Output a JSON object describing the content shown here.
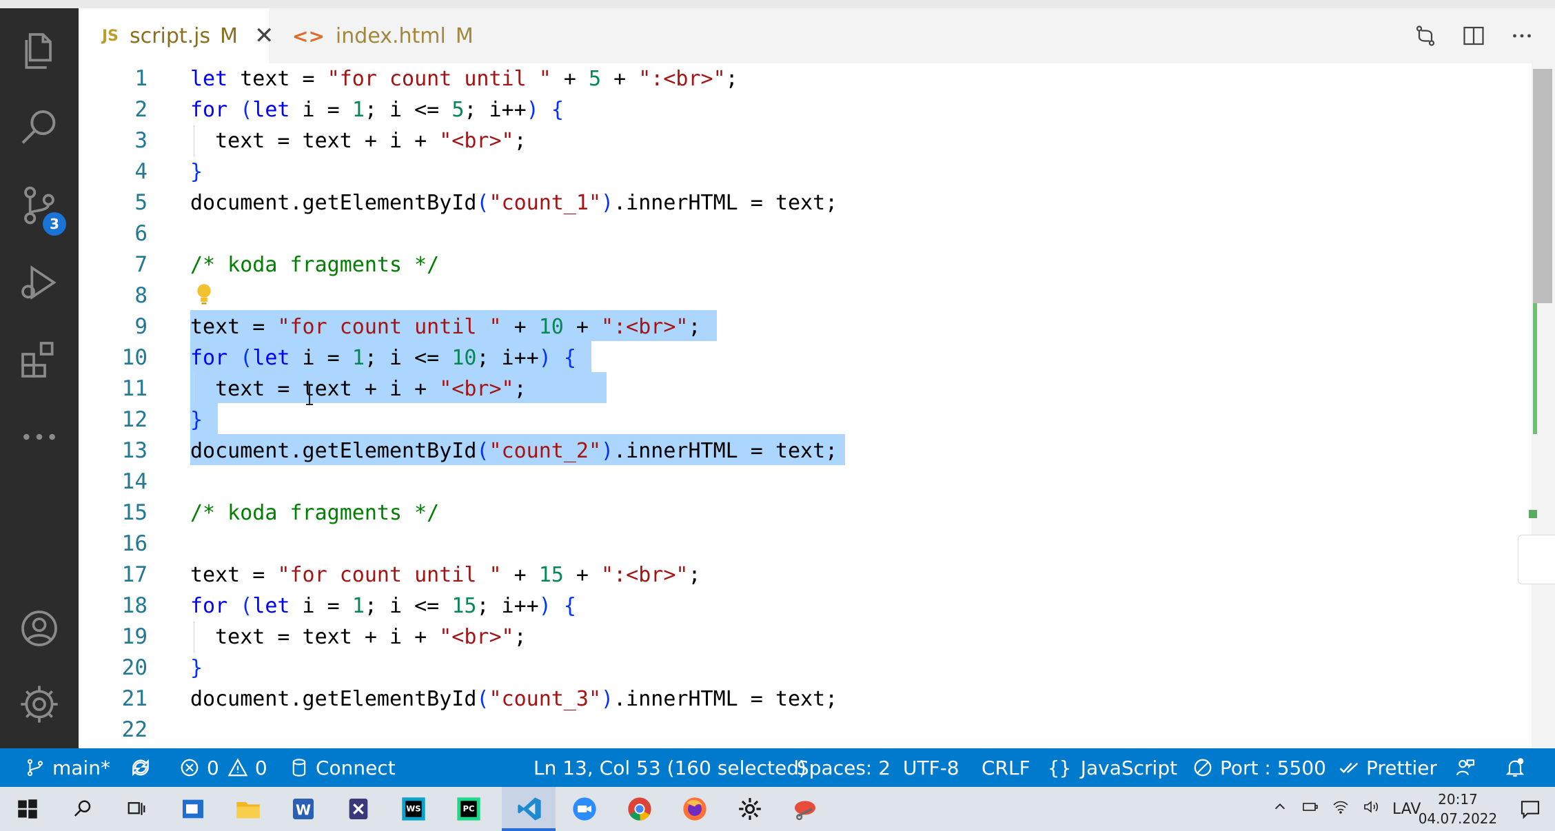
{
  "tabs": [
    {
      "icon_text": "JS",
      "label": "script.js",
      "modified": "M",
      "active": true
    },
    {
      "icon_text": "<>",
      "label": "index.html",
      "modified": "M",
      "active": false
    }
  ],
  "activity_bar": {
    "items": [
      "files-icon",
      "search-icon",
      "source-control-icon",
      "run-debug-icon",
      "extensions-icon",
      "more-icon"
    ],
    "source_control_badge": "3",
    "bottom_items": [
      "account-icon",
      "settings-gear-icon"
    ]
  },
  "editor": {
    "line_numbers": [
      "1",
      "2",
      "3",
      "4",
      "5",
      "6",
      "7",
      "8",
      "9",
      "10",
      "11",
      "12",
      "13",
      "14",
      "15",
      "16",
      "17",
      "18",
      "19",
      "20",
      "21",
      "22"
    ],
    "selected_lines": [
      9,
      10,
      11,
      12,
      13
    ]
  },
  "statusbar": {
    "branch": "main*",
    "errors": "0",
    "warnings": "0",
    "connect": "Connect",
    "cursor_position": "Ln 13, Col 53 (160 selected)",
    "spaces": "Spaces: 2",
    "encoding": "UTF-8",
    "eol": "CRLF",
    "language": "JavaScript",
    "port": "Port : 5500",
    "formatter": "Prettier"
  },
  "taskbar": {
    "tray_language": "LAV",
    "time": "20:17",
    "date": "04.07.2022"
  },
  "colors": {
    "statusbar": "#007acc",
    "activity_bar": "#2c2c2c",
    "selection": "#add6ff",
    "keyword": "#0000ff",
    "string": "#a31515",
    "number": "#098658",
    "comment": "#008000"
  }
}
